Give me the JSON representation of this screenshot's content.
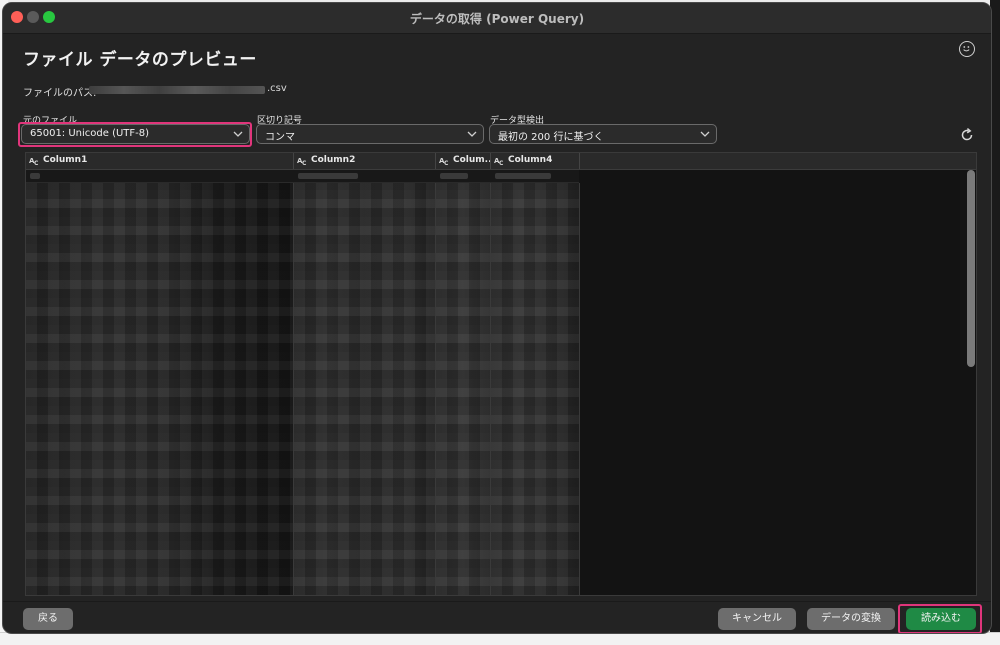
{
  "window": {
    "title": "データの取得 (Power Query)"
  },
  "dialog": {
    "title": "ファイル データのプレビュー",
    "smiley_icon": "smiley-feedback-icon",
    "refresh_icon": "refresh-icon"
  },
  "file_path": {
    "label": "ファイルのパス:",
    "extension": ".csv"
  },
  "options": {
    "origin": {
      "label": "元のファイル",
      "value": "65001: Unicode (UTF-8)"
    },
    "delimiter": {
      "label": "区切り記号",
      "value": "コンマ"
    },
    "detect": {
      "label": "データ型検出",
      "value": "最初の 200 行に基づく"
    }
  },
  "table": {
    "columns": [
      "Column1",
      "Column2",
      "Colum...",
      "Column4"
    ],
    "column_icon": "text-type-icon"
  },
  "footer": {
    "back": "戻る",
    "cancel": "キャンセル",
    "transform": "データの変換",
    "load": "読み込む"
  },
  "colors": {
    "highlight": "#e0357b",
    "primary_button": "#1f8a45",
    "window_bg": "#232323"
  }
}
